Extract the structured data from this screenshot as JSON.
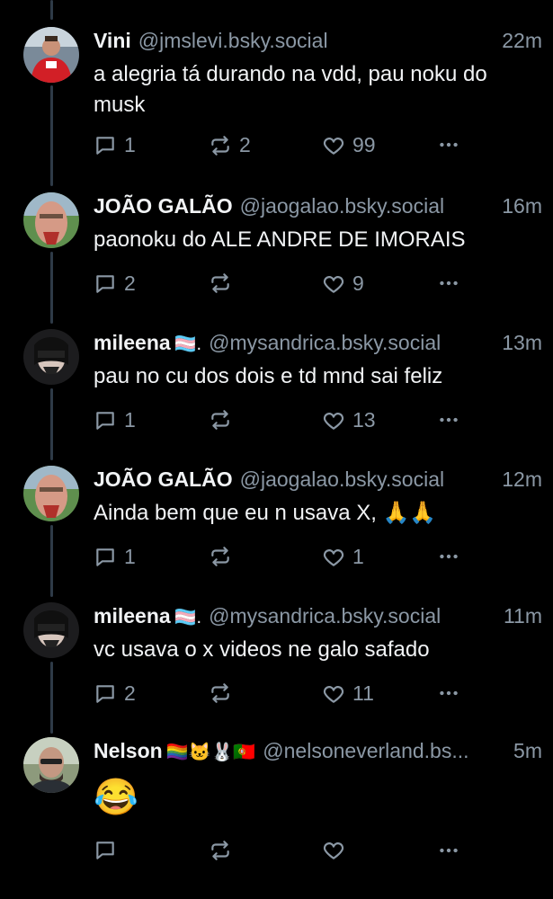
{
  "posts": [
    {
      "name": "Vini",
      "flag": "",
      "handle": "@jmslevi.bsky.social",
      "time": "22m",
      "text": "a alegria tá durando na vdd, pau noku do musk",
      "replies": "1",
      "reposts": "2",
      "likes": "99"
    },
    {
      "name": "JOÃO GALÃO",
      "flag": "",
      "handle": "@jaogalao.bsky.social",
      "time": "16m",
      "text": "paonoku do ALE ANDRE DE IMORAIS",
      "replies": "2",
      "reposts": "",
      "likes": "9"
    },
    {
      "name": "mileena",
      "flag": "🏳️‍⚧️.",
      "handle": "@mysandrica.bsky.social",
      "time": "13m",
      "text": "pau no cu dos dois e td mnd sai feliz",
      "replies": "1",
      "reposts": "",
      "likes": "13"
    },
    {
      "name": "JOÃO GALÃO",
      "flag": "",
      "handle": "@jaogalao.bsky.social",
      "time": "12m",
      "text": "Ainda bem que eu n usava X, 🙏🙏",
      "replies": "1",
      "reposts": "",
      "likes": "1"
    },
    {
      "name": "mileena",
      "flag": "🏳️‍⚧️.",
      "handle": "@mysandrica.bsky.social",
      "time": "11m",
      "text": "vc usava o x videos ne galo safado",
      "replies": "2",
      "reposts": "",
      "likes": "11"
    },
    {
      "name": "Nelson",
      "flag": "🏳️‍🌈🐱🐰🇵🇹",
      "handle": "@nelsoneverland.bs...",
      "time": "5m",
      "text": "😂",
      "replies": "",
      "reposts": "",
      "likes": ""
    }
  ],
  "colors": {
    "background": "#000000",
    "muted": "#8b98a5",
    "text": "#f1f3f5",
    "thread": "#2e3a47"
  },
  "icons": {
    "reply": "speech-bubble-icon",
    "repost": "repost-arrows-icon",
    "like": "heart-icon",
    "more": "ellipsis-icon"
  }
}
